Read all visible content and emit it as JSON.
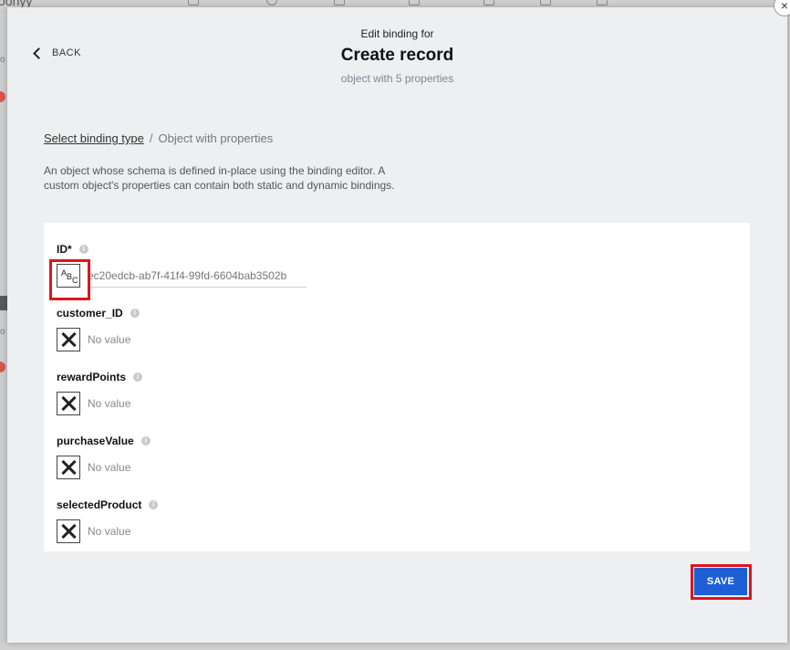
{
  "background": {
    "logo_fragment": "oonyy",
    "left_marks": [
      "o",
      "o"
    ]
  },
  "header": {
    "back_label": "BACK",
    "supertitle": "Edit binding for",
    "title": "Create record",
    "subtitle": "object with 5 properties"
  },
  "breadcrumb": {
    "link_label": "Select binding type",
    "separator": "/",
    "current": "Object with properties"
  },
  "description": "An object whose schema is defined in-place using the binding editor. A custom object's properties can contain both static and dynamic bindings.",
  "fields": [
    {
      "label": "ID*",
      "type_icon": "abc-text-icon",
      "value": "ec20edcb-ab7f-41f4-99fd-6604bab3502b"
    },
    {
      "label": "customer_ID",
      "type_icon": "x-no-value-icon",
      "value": "No value"
    },
    {
      "label": "rewardPoints",
      "type_icon": "x-no-value-icon",
      "value": "No value"
    },
    {
      "label": "purchaseValue",
      "type_icon": "x-no-value-icon",
      "value": "No value"
    },
    {
      "label": "selectedProduct",
      "type_icon": "x-no-value-icon",
      "value": "No value"
    }
  ],
  "type_glyphs": {
    "a": "A",
    "b": "B",
    "c": "C"
  },
  "info_glyph": "i",
  "close_glyph": "×",
  "save_label": "SAVE",
  "colors": {
    "save_button": "#1f5fd6",
    "highlight": "#e0141c",
    "modal_bg": "#eeeff0"
  }
}
